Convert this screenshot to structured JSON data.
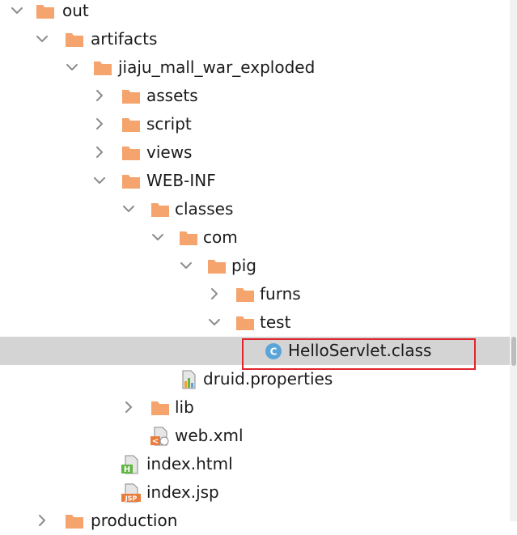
{
  "tree": {
    "rows": [
      {
        "label": "out",
        "icon": "folder-icon",
        "state": "expanded"
      },
      {
        "label": "artifacts",
        "icon": "folder-icon",
        "state": "expanded"
      },
      {
        "label": "jiaju_mall_war_exploded",
        "icon": "folder-icon",
        "state": "expanded"
      },
      {
        "label": "assets",
        "icon": "folder-icon",
        "state": "collapsed"
      },
      {
        "label": "script",
        "icon": "folder-icon",
        "state": "collapsed"
      },
      {
        "label": "views",
        "icon": "folder-icon",
        "state": "collapsed"
      },
      {
        "label": "WEB-INF",
        "icon": "folder-icon",
        "state": "expanded"
      },
      {
        "label": "classes",
        "icon": "folder-icon",
        "state": "expanded"
      },
      {
        "label": "com",
        "icon": "folder-icon",
        "state": "expanded"
      },
      {
        "label": "pig",
        "icon": "folder-icon",
        "state": "expanded"
      },
      {
        "label": "furns",
        "icon": "folder-icon",
        "state": "collapsed"
      },
      {
        "label": "test",
        "icon": "folder-icon",
        "state": "expanded"
      },
      {
        "label": "HelloServlet.class",
        "icon": "java-class-icon",
        "state": "leaf",
        "selected": true,
        "badge": "C"
      },
      {
        "label": "druid.properties",
        "icon": "properties-file-icon",
        "state": "leaf"
      },
      {
        "label": "lib",
        "icon": "folder-icon",
        "state": "collapsed"
      },
      {
        "label": "web.xml",
        "icon": "xml-file-icon",
        "state": "leaf",
        "badge": "<"
      },
      {
        "label": "index.html",
        "icon": "html-file-icon",
        "state": "leaf",
        "badge": "H"
      },
      {
        "label": "index.jsp",
        "icon": "jsp-file-icon",
        "state": "leaf",
        "badge": "JSP"
      },
      {
        "label": "production",
        "icon": "folder-icon",
        "state": "collapsed"
      }
    ]
  },
  "colors": {
    "folder": "#f4a46c",
    "chevron": "#8c8c8c",
    "selection": "#d4d4d4",
    "highlight_box": "#e0242b",
    "class_badge": "#5aa5d8",
    "html_badge": "#62b543",
    "jsp_badge": "#e87d3e"
  }
}
